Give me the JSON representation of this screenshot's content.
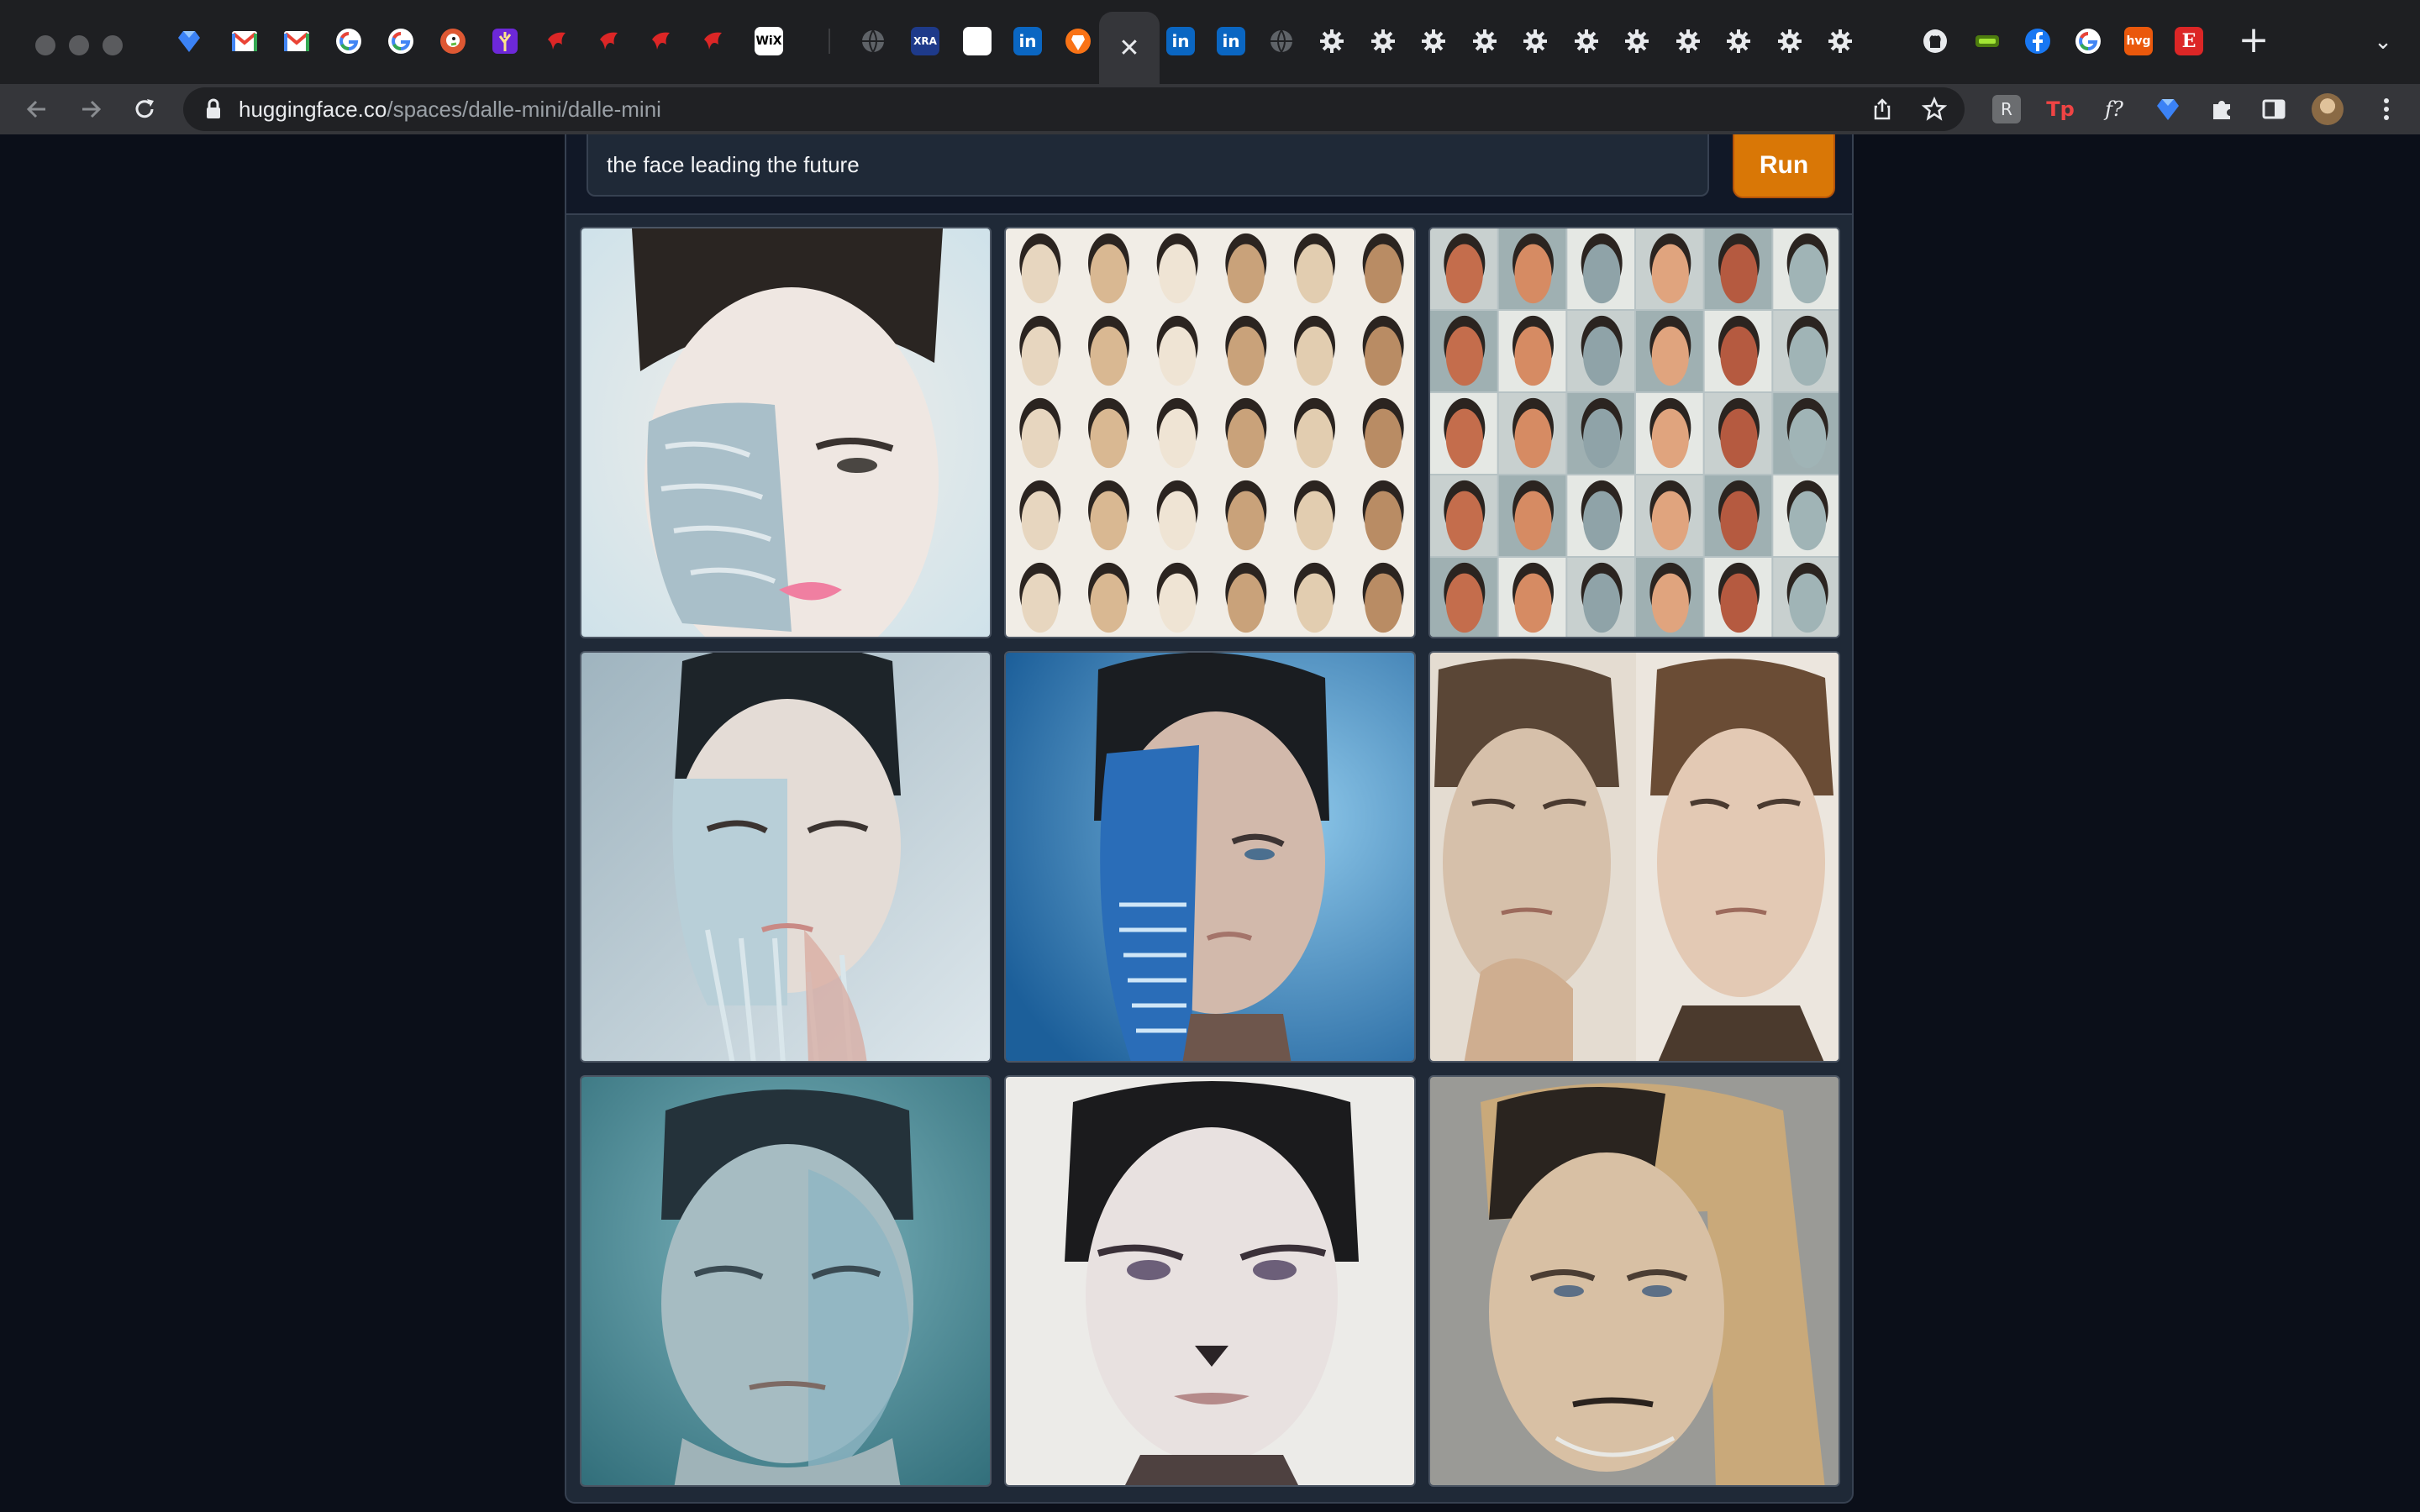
{
  "browser": {
    "active_tab_close": "✕",
    "new_tab": "+",
    "tab_list": "⌄",
    "tab_favicons": [
      "sapphire-icon",
      "gmail-icon",
      "gmail-icon",
      "google-icon",
      "google-icon",
      "duckduckgo-icon",
      "purple-tree-icon",
      "red-bird-icon",
      "red-bird-icon",
      "red-bird-icon",
      "red-bird-icon",
      "wix-icon",
      "globe-icon",
      "xra-icon",
      "white-square-icon",
      "linkedin-icon",
      "brave-icon"
    ],
    "tabs_after_active": [
      "linkedin-icon",
      "linkedin-icon",
      "globe-icon",
      "gear-icon",
      "gear-icon",
      "gear-icon",
      "gear-icon",
      "gear-icon",
      "gear-icon",
      "gear-icon",
      "gear-icon",
      "gear-icon",
      "gear-icon",
      "gear-icon",
      "github-icon",
      "green-pill-icon",
      "facebook-icon",
      "google-icon",
      "hvg-icon",
      "e-icon"
    ],
    "labels": {
      "wix": "WiX",
      "xra": "XRA",
      "linkedin": "in",
      "hvg": "hvg",
      "e": "E"
    },
    "url_host": "huggingface.co",
    "url_path": "/spaces/dalle-mini/dalle-mini",
    "extensions": {
      "reader": "R",
      "tp": "Tp",
      "formula": "f?"
    }
  },
  "app": {
    "prompt": "the face leading the future",
    "run_label": "Run",
    "images": [
      "android-face-with-circuit-half",
      "grid-of-sculpted-heads",
      "grid-of-colored-heads",
      "glass-cyborg-woman",
      "blue-circuit-woman",
      "two-faces-side-by-side",
      "teal-cyborg-man",
      "pale-woman-portrait",
      "blonde-android-woman"
    ]
  }
}
